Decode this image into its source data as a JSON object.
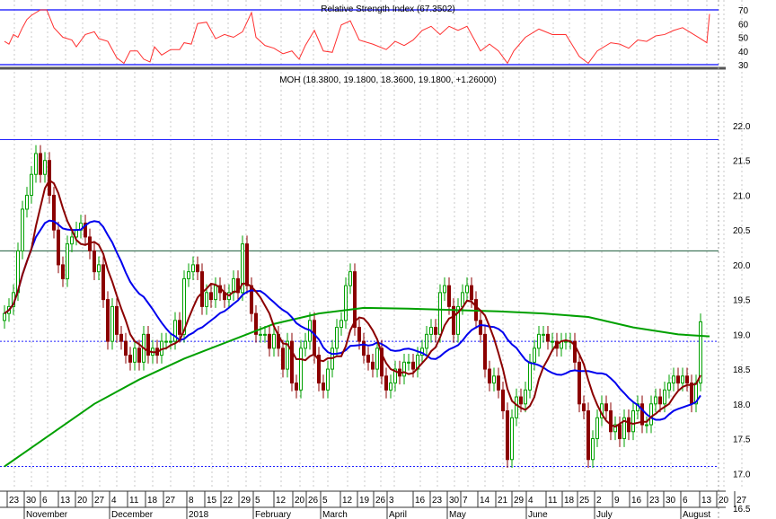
{
  "chart_data": {
    "type": "candlestick",
    "rsi_title": "Relative Strength Index (67.3502)",
    "price_title": "MOH (18.3800, 19.1800, 18.3600, 19.1800, +1.26000)",
    "rsi_ticks": [
      "70",
      "60",
      "50",
      "40",
      "30"
    ],
    "rsi_levels": [
      70,
      30
    ],
    "price_ticks": [
      "22.0",
      "21.5",
      "21.0",
      "20.5",
      "20.0",
      "19.5",
      "19.0",
      "18.5",
      "18.0",
      "17.5",
      "17.0",
      "16.5"
    ],
    "ylim": [
      16.5,
      22.0
    ],
    "hlines": {
      "blue_solid": 21.8,
      "green_solid": 20.2,
      "blue_dotted_upper": 18.9,
      "blue_dotted_lower": 17.1
    },
    "date_ticks": [
      "23",
      "30",
      "6",
      "13",
      "20",
      "27",
      "4",
      "11",
      "18",
      "27",
      "8",
      "15",
      "22",
      "29",
      "5",
      "12",
      "20",
      "26",
      "5",
      "12",
      "19",
      "26",
      "3",
      "16",
      "23",
      "30",
      "7",
      "14",
      "21",
      "29",
      "4",
      "11",
      "18",
      "25",
      "2",
      "9",
      "16",
      "23",
      "30",
      "6",
      "13",
      "20",
      "27"
    ],
    "months": [
      "November",
      "December",
      "2018",
      "February",
      "March",
      "April",
      "May",
      "June",
      "July",
      "August"
    ],
    "closes": [
      19.3,
      19.4,
      19.6,
      20.2,
      20.8,
      21.0,
      21.3,
      21.6,
      21.3,
      21.5,
      21.0,
      20.5,
      20.0,
      19.8,
      20.3,
      20.4,
      20.5,
      20.6,
      20.4,
      20.2,
      19.9,
      20.0,
      19.5,
      18.9,
      19.4,
      19.0,
      18.9,
      18.7,
      18.6,
      18.8,
      18.6,
      19.0,
      18.7,
      18.8,
      18.7,
      18.9,
      18.9,
      18.9,
      19.2,
      19.0,
      19.8,
      19.9,
      20.0,
      19.9,
      19.4,
      19.6,
      19.5,
      19.7,
      19.6,
      19.5,
      19.6,
      19.8,
      19.6,
      20.3,
      19.7,
      19.3,
      19.0,
      19.0,
      19.0,
      18.8,
      19.0,
      18.8,
      18.5,
      18.9,
      18.3,
      18.2,
      18.8,
      18.9,
      19.2,
      18.7,
      18.3,
      18.2,
      18.5,
      18.8,
      19.1,
      19.2,
      19.7,
      19.9,
      19.1,
      18.9,
      18.7,
      18.6,
      18.5,
      18.8,
      18.4,
      18.2,
      18.3,
      18.5,
      18.4,
      18.6,
      18.6,
      18.5,
      18.7,
      18.8,
      19.0,
      19.1,
      19.0,
      19.6,
      19.7,
      19.4,
      19.0,
      19.4,
      19.6,
      19.7,
      19.5,
      19.2,
      19.0,
      18.5,
      18.3,
      18.4,
      18.2,
      17.9,
      17.2,
      17.8,
      18.1,
      18.0,
      18.2,
      18.6,
      18.8,
      19.0,
      19.0,
      18.9,
      18.9,
      18.8,
      18.9,
      18.9,
      18.9,
      18.6,
      18.0,
      17.9,
      17.2,
      17.5,
      17.8,
      18.0,
      17.9,
      17.6,
      17.7,
      17.5,
      17.8,
      17.6,
      17.9,
      18.0,
      17.7,
      17.7,
      18.0,
      18.1,
      18.0,
      18.2,
      18.3,
      18.4,
      18.3,
      18.4,
      18.3,
      18.0,
      18.3,
      19.18
    ],
    "long_ma": [
      [
        0,
        17.1
      ],
      [
        10,
        17.55
      ],
      [
        20,
        18.0
      ],
      [
        30,
        18.35
      ],
      [
        40,
        18.65
      ],
      [
        50,
        18.9
      ],
      [
        60,
        19.15
      ],
      [
        70,
        19.3
      ],
      [
        80,
        19.38
      ],
      [
        90,
        19.37
      ],
      [
        100,
        19.35
      ],
      [
        110,
        19.33
      ],
      [
        120,
        19.3
      ],
      [
        130,
        19.25
      ],
      [
        140,
        19.1
      ],
      [
        150,
        19.0
      ],
      [
        157,
        18.97
      ]
    ],
    "rsi": [
      [
        0,
        47
      ],
      [
        1,
        45
      ],
      [
        2,
        52
      ],
      [
        3,
        50
      ],
      [
        4,
        57
      ],
      [
        5,
        63
      ],
      [
        6,
        66
      ],
      [
        8,
        70
      ],
      [
        9.4,
        70
      ],
      [
        11,
        57
      ],
      [
        13,
        50
      ],
      [
        15,
        48
      ],
      [
        16,
        43
      ],
      [
        18,
        52
      ],
      [
        20,
        54
      ],
      [
        21,
        49
      ],
      [
        23,
        47
      ],
      [
        25,
        35
      ],
      [
        26.6,
        31
      ],
      [
        28,
        40
      ],
      [
        29.6,
        40
      ],
      [
        31,
        34
      ],
      [
        32.4,
        32
      ],
      [
        33.4,
        43
      ],
      [
        35,
        37
      ],
      [
        37,
        41
      ],
      [
        39,
        41
      ],
      [
        40,
        46
      ],
      [
        41.6,
        45
      ],
      [
        43,
        60
      ],
      [
        45,
        61
      ],
      [
        47,
        49
      ],
      [
        49,
        52
      ],
      [
        51,
        50
      ],
      [
        53,
        54
      ],
      [
        55,
        68
      ],
      [
        56,
        50
      ],
      [
        58,
        44
      ],
      [
        60,
        42
      ],
      [
        62,
        38
      ],
      [
        64,
        40
      ],
      [
        65.6,
        34
      ],
      [
        67,
        44
      ],
      [
        69,
        55
      ],
      [
        71,
        40
      ],
      [
        73,
        39
      ],
      [
        75,
        59
      ],
      [
        77,
        62
      ],
      [
        79,
        48
      ],
      [
        82,
        45
      ],
      [
        85,
        41
      ],
      [
        87,
        47
      ],
      [
        89,
        44
      ],
      [
        91,
        48
      ],
      [
        93,
        55
      ],
      [
        95,
        58
      ],
      [
        97,
        52
      ],
      [
        99,
        58
      ],
      [
        101,
        55
      ],
      [
        103,
        58
      ],
      [
        106,
        40
      ],
      [
        108,
        45
      ],
      [
        110,
        40
      ],
      [
        112,
        31
      ],
      [
        113.4,
        40
      ],
      [
        116,
        50
      ],
      [
        119,
        56
      ],
      [
        122,
        52
      ],
      [
        125,
        52
      ],
      [
        128,
        36
      ],
      [
        130,
        31
      ],
      [
        132,
        40
      ],
      [
        135,
        46
      ],
      [
        137,
        45
      ],
      [
        139,
        42
      ],
      [
        141,
        48
      ],
      [
        143,
        47
      ],
      [
        145,
        51
      ],
      [
        147,
        52
      ],
      [
        149,
        55
      ],
      [
        151,
        57
      ],
      [
        153,
        53
      ],
      [
        155,
        49
      ],
      [
        156.4,
        46
      ],
      [
        157,
        67
      ]
    ]
  }
}
